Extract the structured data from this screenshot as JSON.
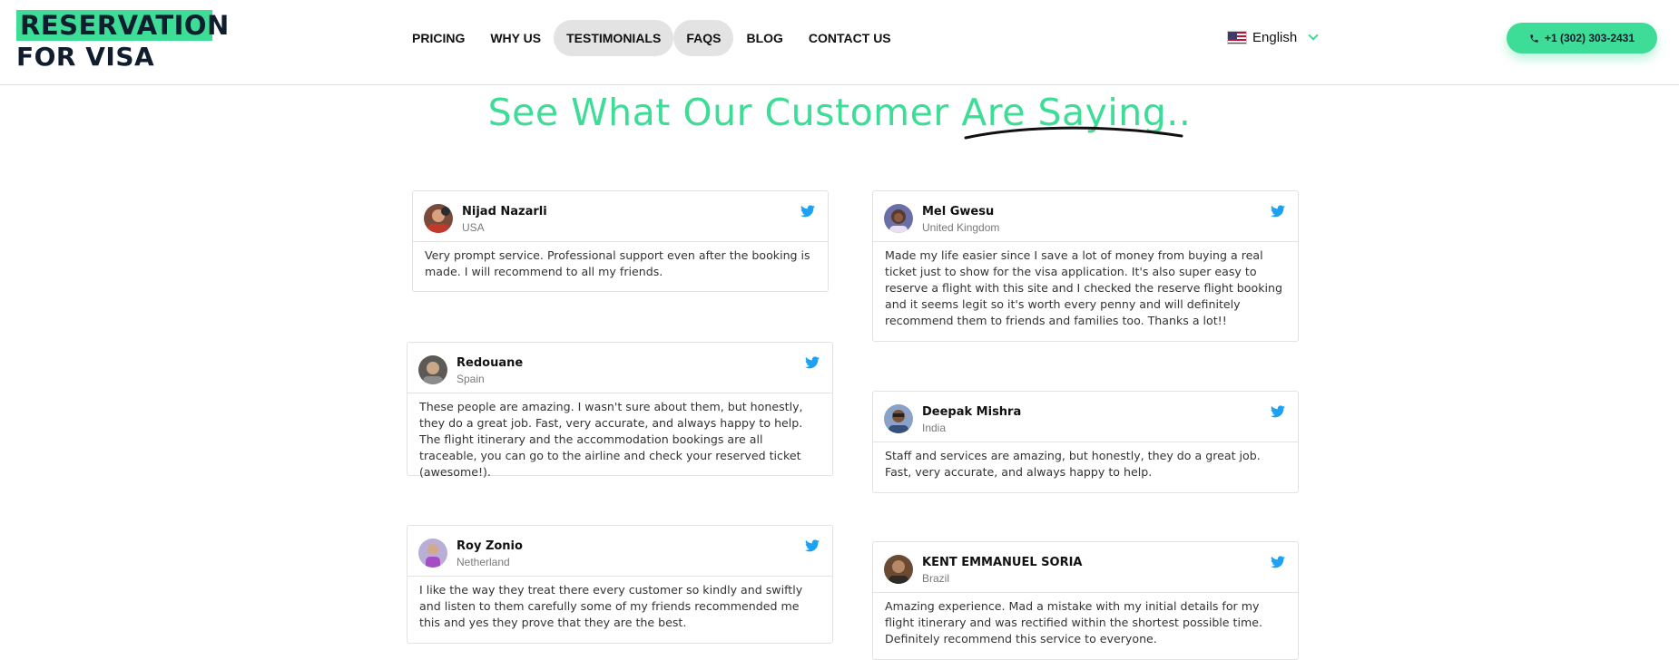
{
  "header": {
    "logo": {
      "line1": "RESERVATION",
      "line2": "FOR VISA"
    },
    "nav": [
      {
        "label": "PRICING",
        "active": false
      },
      {
        "label": "WHY US",
        "active": false
      },
      {
        "label": "TESTIMONIALS",
        "active": true
      },
      {
        "label": "FAQS",
        "active": true
      },
      {
        "label": "BLOG",
        "active": false
      },
      {
        "label": "CONTACT US",
        "active": false
      }
    ],
    "language": {
      "flag_icon": "us-flag-icon",
      "label": "English"
    },
    "phone": {
      "icon": "phone-icon",
      "label": "+1 (302) 303-2431"
    }
  },
  "heading": {
    "title": "See What Our Customer Are Saying.."
  },
  "colors": {
    "accent": "#3ddc97",
    "dark": "#0f1d2e",
    "twitter": "#1da1f2",
    "nav_active_bg": "#e3e3e3"
  },
  "testimonials": [
    {
      "name": "Nijad Nazarli",
      "country": "USA",
      "text": "Very prompt service. Professional support even after the booking is made. I will recommend to all my friends.",
      "icon": "twitter-icon"
    },
    {
      "name": "Mel Gwesu",
      "country": "United Kingdom",
      "text": "Made my life easier since I save a lot of money from buying a real ticket just to show for the visa application. It's also super easy to reserve a flight with this site and I checked the reserve flight booking and it seems legit so it's worth every penny and will definitely recommend them to friends and families too. Thanks a lot!!",
      "icon": "twitter-icon"
    },
    {
      "name": "Redouane",
      "country": "Spain",
      "text": "These people are amazing. I wasn't sure about them, but honestly, they do a great job. Fast, very accurate, and always happy to help. The flight itinerary and the accommodation bookings are all traceable, you can go to the airline and check your reserved ticket (awesome!).",
      "icon": "twitter-icon"
    },
    {
      "name": "Deepak Mishra",
      "country": "India",
      "text": "Staff and services are amazing, but honestly, they do a great job. Fast, very accurate, and always happy to help.",
      "icon": "twitter-icon"
    },
    {
      "name": "Roy Zonio",
      "country": "Netherland",
      "text": "I like the way they treat there every customer so kindly and swiftly and listen to them carefully some of my friends recommended me this and yes they prove that they are the best.",
      "icon": "twitter-icon"
    },
    {
      "name": "KENT EMMANUEL SORIA",
      "country": "Brazil",
      "text": "Amazing experience. Mad a mistake with my initial details for my flight itinerary and was rectified within the shortest possible time. Definitely recommend this service to everyone.",
      "icon": "twitter-icon"
    }
  ]
}
